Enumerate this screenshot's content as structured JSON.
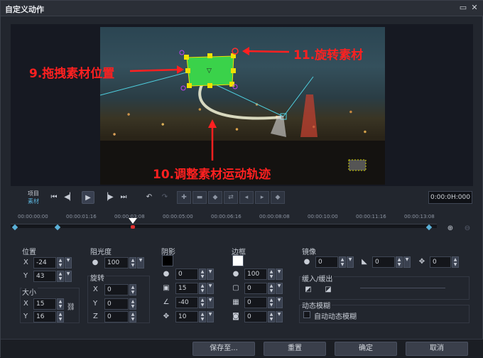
{
  "window": {
    "title": "自定义动作"
  },
  "annotations": {
    "drag": "9.拖拽素材位置",
    "rotate": "11.旋转素材",
    "path": "10.调整素材运动轨迹"
  },
  "playback": {
    "mode_project": "项目",
    "mode_clip": "素材",
    "timecode": "0:00:0H:000"
  },
  "timeline": {
    "ticks": [
      "00:00:00:00",
      "00:00:01:16",
      "00:00:03:08",
      "00:00:05:00",
      "00:00:06:16",
      "00:00:08:08",
      "00:00:10:00",
      "00:00:11:16",
      "00:00:13:08"
    ]
  },
  "position": {
    "title": "位置",
    "x_label": "X",
    "x": "-24",
    "y_label": "Y",
    "y": "43"
  },
  "size": {
    "title": "大小",
    "x_label": "X",
    "x": "15",
    "y_label": "Y",
    "y": "16"
  },
  "opacity": {
    "title": "阻光度",
    "value": "100"
  },
  "rotation": {
    "title": "旋转",
    "x_label": "X",
    "x": "0",
    "y_label": "Y",
    "y": "0",
    "z_label": "Z",
    "z": "0"
  },
  "shadow": {
    "title": "阴影",
    "color": "#000000",
    "opacity": "0",
    "blur": "15",
    "angle": "-40",
    "distance": "10"
  },
  "border": {
    "title": "边框",
    "color": "#ffffff",
    "opacity": "100",
    "width": "0",
    "v2": "0",
    "v3": "0"
  },
  "mirror": {
    "title": "镜像",
    "v1": "0",
    "v2": "0",
    "v3": "0"
  },
  "ease": {
    "title": "缓入/缓出"
  },
  "motion_blur": {
    "title": "动态模糊",
    "auto_label": "自动动态模糊"
  },
  "footer": {
    "save_to": "保存至...",
    "reset": "重置",
    "ok": "确定",
    "cancel": "取消"
  },
  "colors": {
    "accent": "#e03030",
    "clip": "#3ad24a",
    "keyframe": "#5ab0d8"
  }
}
